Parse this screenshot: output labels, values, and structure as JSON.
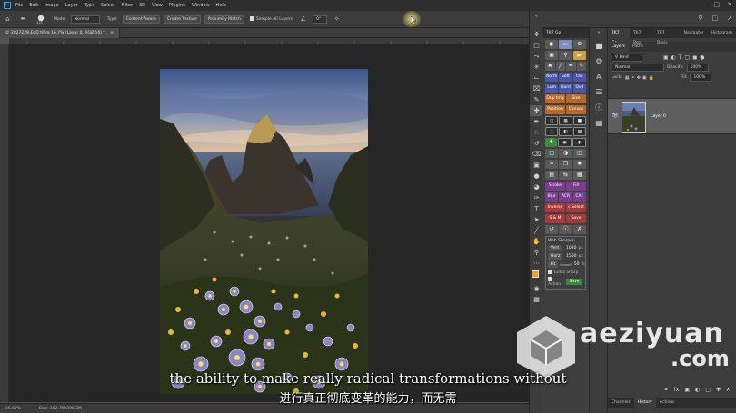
{
  "menu": {
    "app_icon": "Ps",
    "items": [
      "File",
      "Edit",
      "Image",
      "Layer",
      "Type",
      "Select",
      "Filter",
      "3D",
      "View",
      "Plugins",
      "Window",
      "Help"
    ]
  },
  "options": {
    "size": "125",
    "mode_label": "Mode:",
    "mode_value": "Normal",
    "type_label": "Type:",
    "type_options": [
      "Content-Aware",
      "Create Texture",
      "Proximity Match"
    ],
    "sample_all_layers": "Sample All Layers",
    "angle": "0°"
  },
  "document": {
    "tab_title": "© 2027228-EdD.tif @ 16.7% (Layer 0, RGB/16) *",
    "zoom": "16.67%",
    "doc_info": "Doc: 162.7M/396.3M"
  },
  "tk7": {
    "tab1": "TK7 Go",
    "buttons": [
      [
        "Norm",
        "Soft",
        "Ovl"
      ],
      [
        "Lum",
        "Hard",
        "Dvd"
      ],
      [
        "Dup Img",
        "Size"
      ],
      [
        "Position",
        "Canvas"
      ],
      [
        "Stroke",
        "Fill"
      ],
      [
        "Blur",
        "ACR",
        "CAF"
      ],
      [
        "Inverse",
        "c Select"
      ],
      [
        "S & M",
        "Save"
      ]
    ],
    "web_sharpen": {
      "title": "Web Sharpen",
      "vert_label": "Vert",
      "vert_value": "1080",
      "horz_label": "Horz",
      "horz_value": "1500",
      "unit": "px",
      "fit_label": "Fit",
      "smooth_label": "Smooth",
      "smooth_value": "50",
      "pct": "%",
      "extra_sharp": "Extra Sharp",
      "action": "Action",
      "save": "Save"
    }
  },
  "panels": {
    "top_tabs": [
      "TK7 Go",
      "TK7 Bsp",
      "TK7 Basic",
      "Navigator",
      "Histogram"
    ],
    "layer_tabs": [
      "Layers",
      "Paths"
    ],
    "kind": "Kind",
    "blend": "Normal",
    "opacity_label": "Opacity:",
    "opacity_value": "100%",
    "lock_label": "Lock:",
    "fill_label": "Fill:",
    "fill_value": "100%",
    "layer_name": "Layer 0",
    "bottom_tabs": [
      "Channels",
      "History",
      "Actions"
    ]
  },
  "subtitles": {
    "english": "the ability to make really radical transformations without",
    "chinese": "进行真正彻底变革的能力，而无需"
  },
  "watermark": {
    "line1": "aeziyuan",
    "line2": ".com"
  },
  "icons": [
    "home-icon",
    "brush-icon",
    "move-icon",
    "marquee-icon",
    "lasso-icon",
    "crop-icon",
    "eyedropper-icon",
    "healing-icon",
    "stamp-icon",
    "eraser-icon",
    "gradient-icon",
    "pen-icon",
    "type-icon",
    "hand-icon",
    "zoom-icon",
    "search-icon",
    "share-icon"
  ]
}
